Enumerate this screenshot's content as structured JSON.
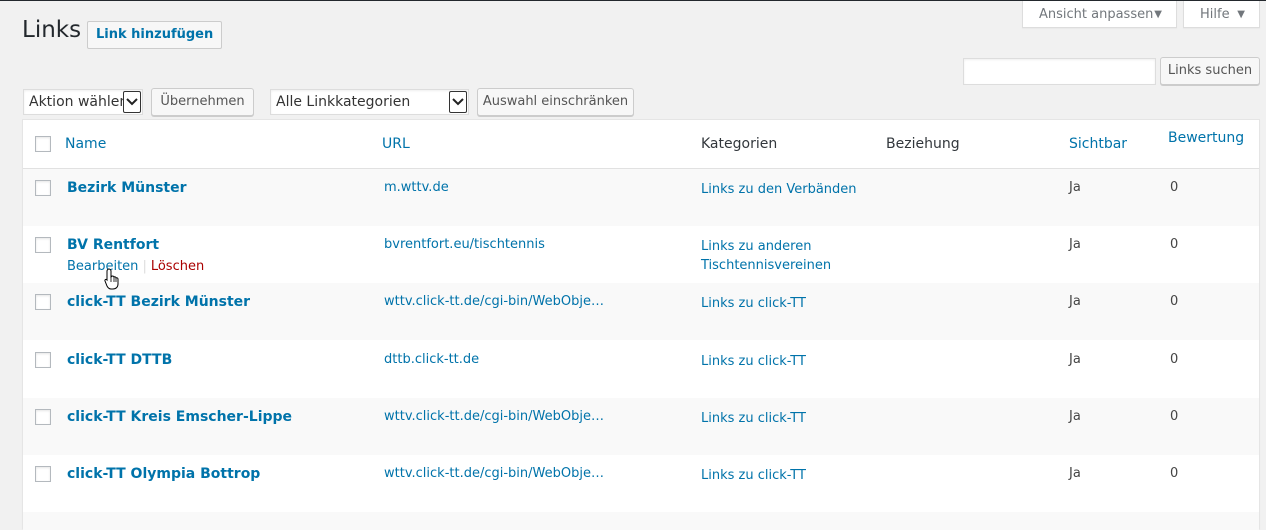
{
  "header": {
    "screen_options": "Ansicht anpassen",
    "help": "Hilfe",
    "title": "Links",
    "add_link": "Link hinzufügen"
  },
  "search": {
    "value": "",
    "button": "Links suchen"
  },
  "filters": {
    "bulk_action": "Aktion wählen",
    "apply": "Übernehmen",
    "category": "Alle Linkkategorien",
    "filter_button": "Auswahl einschränken"
  },
  "table": {
    "columns": [
      "Name",
      "URL",
      "Kategorien",
      "Beziehung",
      "Sichtbar",
      "Bewertung"
    ],
    "rows": [
      {
        "name": "Bezirk Münster",
        "url": "m.wttv.de",
        "category_line1": "Links zu den Verbänden",
        "category_line2": "",
        "relationship": "",
        "visible": "Ja",
        "rating": "0"
      },
      {
        "name": "BV Rentfort",
        "url": "bvrentfort.eu/tischtennis",
        "category_line1": "Links zu anderen",
        "category_line2": "Tischtennisvereinen",
        "relationship": "",
        "visible": "Ja",
        "rating": "0"
      },
      {
        "name": "click-TT Bezirk Münster",
        "url": "wttv.click-tt.de/cgi-bin/WebObje…",
        "category_line1": "Links zu click-TT",
        "category_line2": "",
        "relationship": "",
        "visible": "Ja",
        "rating": "0"
      },
      {
        "name": "click-TT DTTB",
        "url": "dttb.click-tt.de",
        "category_line1": "Links zu click-TT",
        "category_line2": "",
        "relationship": "",
        "visible": "Ja",
        "rating": "0"
      },
      {
        "name": "click-TT Kreis Emscher-Lippe",
        "url": "wttv.click-tt.de/cgi-bin/WebObje…",
        "category_line1": "Links zu click-TT",
        "category_line2": "",
        "relationship": "",
        "visible": "Ja",
        "rating": "0"
      },
      {
        "name": "click-TT Olympia Bottrop",
        "url": "wttv.click-tt.de/cgi-bin/WebObje…",
        "category_line1": "Links zu click-TT",
        "category_line2": "",
        "relationship": "",
        "visible": "Ja",
        "rating": "0"
      }
    ],
    "row_actions": {
      "edit": "Bearbeiten",
      "sep": "|",
      "delete": "Löschen"
    }
  },
  "colors": {
    "link": "#0073aa",
    "delete": "#aa0000",
    "background": "#f1f1f1"
  },
  "icons": {
    "dropdown": "chevron-down-icon",
    "cursor": "hand-pointer-icon"
  }
}
